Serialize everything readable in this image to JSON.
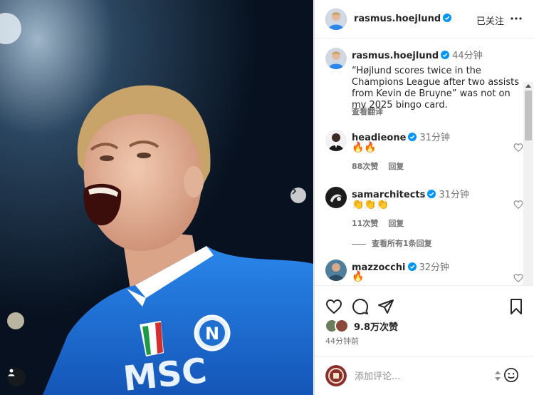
{
  "post": {
    "author": "rasmus.hoejlund",
    "follow_label": "已关注",
    "more_icon": "more-horizontal-icon"
  },
  "caption": {
    "username": "rasmus.hoejlund",
    "time": "44分钟",
    "text": "“Højlund scores twice in the Champions League after two assists from Kevin de Bruyne” was not on my 2025 bingo card.",
    "translate_label": "查看翻译"
  },
  "comments": [
    {
      "username": "headieone",
      "time": "31分钟",
      "emojis": "🔥🔥",
      "likes": "88次赞",
      "reply_label": "回复"
    },
    {
      "username": "samarchitects",
      "time": "31分钟",
      "emojis": "👏👏👏",
      "likes": "11次赞",
      "reply_label": "回复"
    },
    {
      "username": "mazzocchi",
      "time": "32分钟",
      "emojis": "🔥"
    }
  ],
  "view_replies_label": "查看所有1条回复",
  "likes_count": "9.8万次赞",
  "posted_ago": "44分钟前",
  "composer": {
    "placeholder": "添加评论..."
  },
  "colors": {
    "verified": "#0095f6",
    "jersey": "#1b6fd6",
    "text": "#262626",
    "secondary": "#737373"
  }
}
